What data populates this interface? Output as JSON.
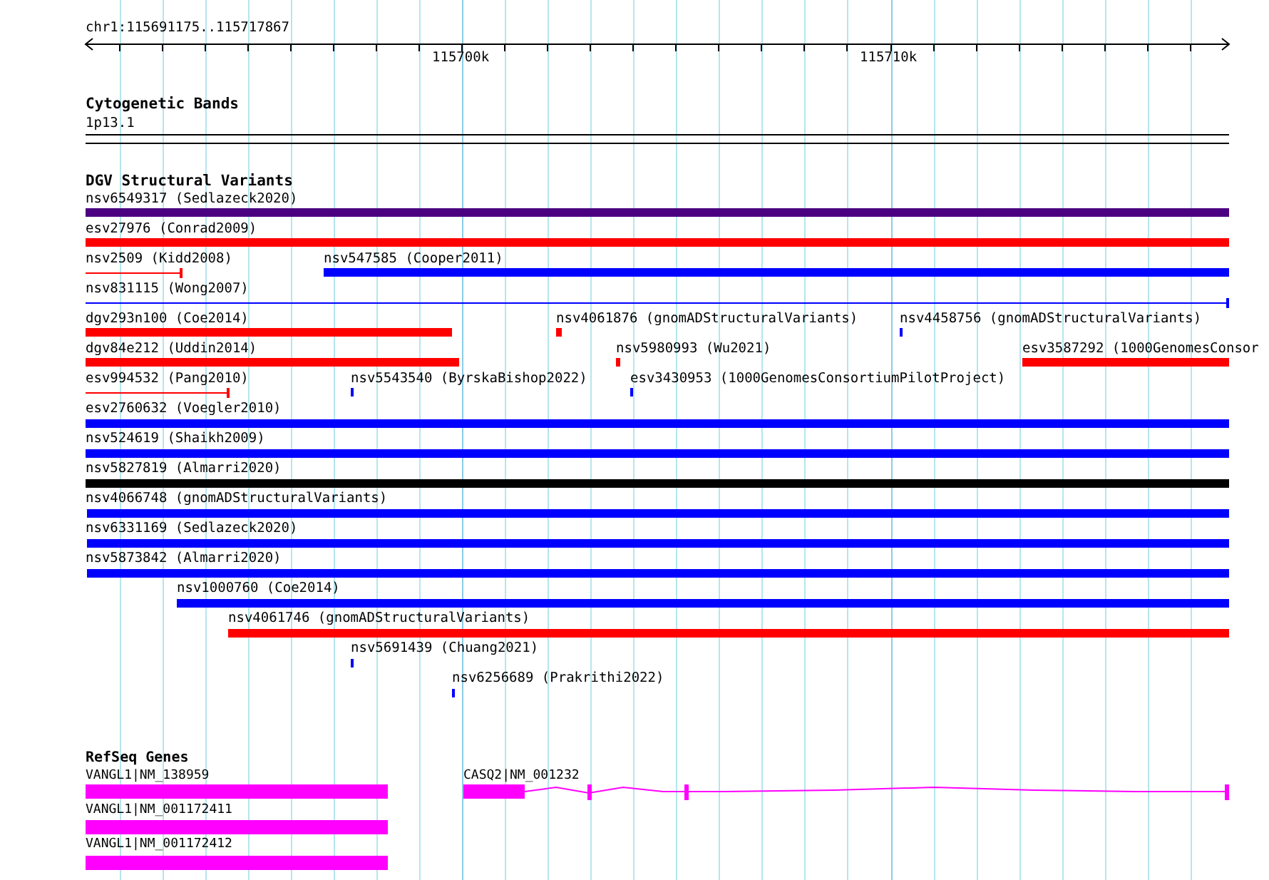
{
  "ruler": {
    "location": "chr1:115691175..115717867",
    "ticks": [
      "115700k",
      "115710k"
    ]
  },
  "cytogenetic": {
    "title": "Cytogenetic Bands",
    "band": "1p13.1"
  },
  "dgv": {
    "title": "DGV Structural Variants",
    "variants": [
      {
        "label": "nsv6549317 (Sedlazeck2020)",
        "kind": "span",
        "color": "#4b0082"
      },
      {
        "label": "esv27976 (Conrad2009)",
        "kind": "span",
        "color": "#ff0000"
      },
      {
        "label": "nsv2509 (Kidd2008)",
        "kind": "line",
        "color": "#ff0000"
      },
      {
        "label": "nsv547585 (Cooper2011)",
        "kind": "span",
        "color": "#0000ff"
      },
      {
        "label": "nsv831115 (Wong2007)",
        "kind": "line",
        "color": "#0000ff"
      },
      {
        "label": "dgv293n100 (Coe2014)",
        "kind": "span",
        "color": "#ff0000"
      },
      {
        "label": "nsv4061876 (gnomADStructuralVariants)",
        "kind": "point",
        "color": "#ff0000"
      },
      {
        "label": "nsv4458756 (gnomADStructuralVariants)",
        "kind": "point",
        "color": "#0000ff"
      },
      {
        "label": "dgv84e212 (Uddin2014)",
        "kind": "span",
        "color": "#ff0000"
      },
      {
        "label": "nsv5980993 (Wu2021)",
        "kind": "point",
        "color": "#ff0000"
      },
      {
        "label": "esv3587292 (1000GenomesConsor",
        "kind": "span",
        "color": "#ff0000"
      },
      {
        "label": "esv994532 (Pang2010)",
        "kind": "line",
        "color": "#ff0000"
      },
      {
        "label": "nsv5543540 (ByrskaBishop2022)",
        "kind": "point",
        "color": "#0000ff"
      },
      {
        "label": "esv3430953 (1000GenomesConsortiumPilotProject)",
        "kind": "point",
        "color": "#0000ff"
      },
      {
        "label": "esv2760632 (Voegler2010)",
        "kind": "span",
        "color": "#0000ff"
      },
      {
        "label": "nsv524619 (Shaikh2009)",
        "kind": "span",
        "color": "#0000ff"
      },
      {
        "label": "nsv5827819 (Almarri2020)",
        "kind": "span",
        "color": "#000000"
      },
      {
        "label": "nsv4066748 (gnomADStructuralVariants)",
        "kind": "span",
        "color": "#0000ff"
      },
      {
        "label": "nsv6331169 (Sedlazeck2020)",
        "kind": "span",
        "color": "#0000ff"
      },
      {
        "label": "nsv5873842 (Almarri2020)",
        "kind": "span",
        "color": "#0000ff"
      },
      {
        "label": "nsv1000760 (Coe2014)",
        "kind": "span",
        "color": "#0000ff"
      },
      {
        "label": "nsv4061746 (gnomADStructuralVariants)",
        "kind": "span",
        "color": "#ff0000"
      },
      {
        "label": "nsv5691439 (Chuang2021)",
        "kind": "point",
        "color": "#0000ff"
      },
      {
        "label": "nsv6256689 (Prakrithi2022)",
        "kind": "point",
        "color": "#0000ff"
      }
    ]
  },
  "refseq": {
    "title": "RefSeq Genes",
    "transcripts": [
      {
        "label": "VANGL1|NM_138959",
        "kind": "block"
      },
      {
        "label": "VANGL1|NM_001172411",
        "kind": "block"
      },
      {
        "label": "VANGL1|NM_001172412",
        "kind": "block"
      },
      {
        "label": "CASQ2|NM_001232",
        "kind": "exons"
      }
    ]
  }
}
